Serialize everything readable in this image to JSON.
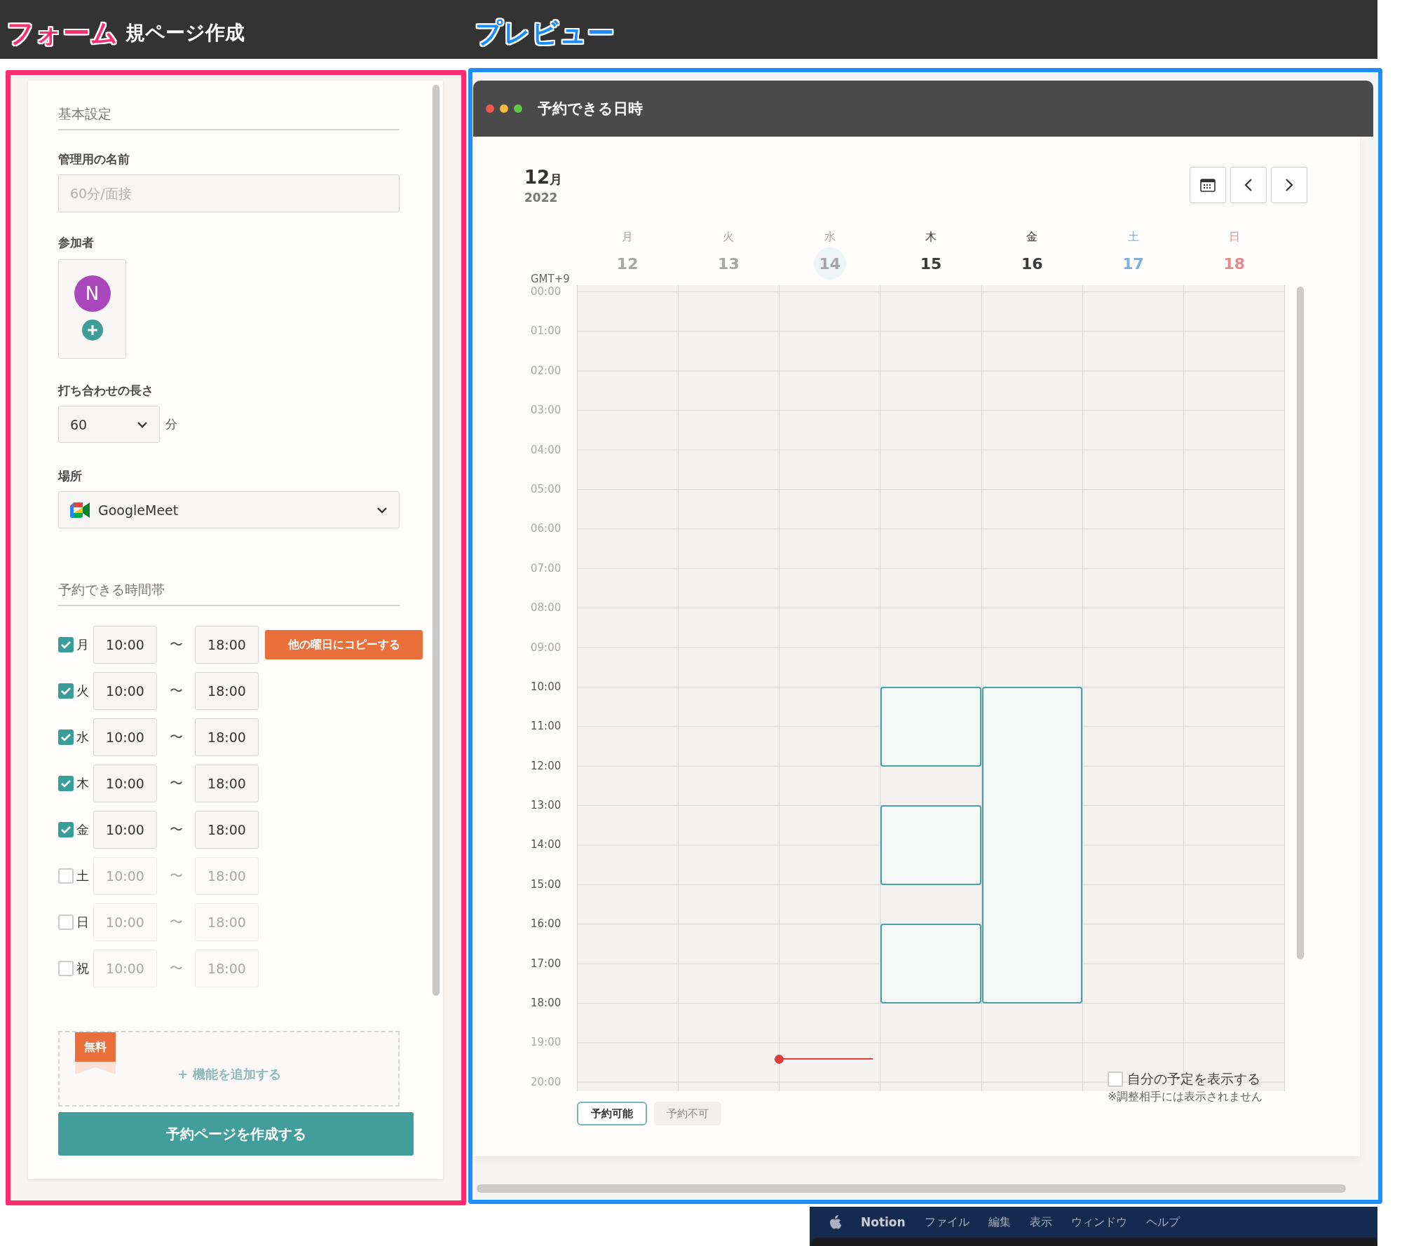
{
  "header": {
    "form_label": "フォーム",
    "page_title": "規ページ作成",
    "preview_label": "プレビュー"
  },
  "form": {
    "basic_section": "基本設定",
    "name_field": {
      "label": "管理用の名前",
      "placeholder": "60分/面接"
    },
    "participants": {
      "label": "参加者",
      "avatars": [
        {
          "initial": "N"
        }
      ]
    },
    "duration": {
      "label": "打ち合わせの長さ",
      "value": "60",
      "unit": "分"
    },
    "location": {
      "label": "場所",
      "value": "GoogleMeet"
    },
    "hours_section": "予約できる時間帯",
    "days": [
      {
        "label": "月",
        "checked": true,
        "start": "10:00",
        "separator": "〜",
        "end": "18:00"
      },
      {
        "label": "火",
        "checked": true,
        "start": "10:00",
        "separator": "〜",
        "end": "18:00"
      },
      {
        "label": "水",
        "checked": true,
        "start": "10:00",
        "separator": "〜",
        "end": "18:00"
      },
      {
        "label": "木",
        "checked": true,
        "start": "10:00",
        "separator": "〜",
        "end": "18:00"
      },
      {
        "label": "金",
        "checked": true,
        "start": "10:00",
        "separator": "〜",
        "end": "18:00"
      },
      {
        "label": "土",
        "checked": false,
        "start": "10:00",
        "separator": "〜",
        "end": "18:00"
      },
      {
        "label": "日",
        "checked": false,
        "start": "10:00",
        "separator": "〜",
        "end": "18:00"
      },
      {
        "label": "祝",
        "checked": false,
        "start": "10:00",
        "separator": "〜",
        "end": "18:00"
      }
    ],
    "copy_button": "他の曜日にコピーする",
    "add_feature": {
      "badge": "無料",
      "label": "+ 機能を追加する"
    },
    "submit_button": "予約ページを作成する"
  },
  "preview": {
    "window_title": "予約できる日時",
    "month": "12",
    "month_unit": "月",
    "year": "2022",
    "timezone": "GMT+9",
    "days": [
      {
        "weekday": "月",
        "date": "12",
        "kind": "weekday",
        "available": false,
        "today": false
      },
      {
        "weekday": "火",
        "date": "13",
        "kind": "weekday",
        "available": false,
        "today": false
      },
      {
        "weekday": "水",
        "date": "14",
        "kind": "weekday",
        "available": false,
        "today": true
      },
      {
        "weekday": "木",
        "date": "15",
        "kind": "weekday",
        "available": true,
        "today": false,
        "open_hours": [
          false,
          false,
          false,
          false,
          false,
          false,
          false,
          false,
          false,
          false,
          true,
          true,
          false,
          true,
          true,
          false,
          true,
          true,
          false,
          false
        ]
      },
      {
        "weekday": "金",
        "date": "16",
        "kind": "weekday",
        "available": true,
        "today": false,
        "open_hours": [
          false,
          false,
          false,
          false,
          false,
          false,
          false,
          false,
          false,
          false,
          true,
          true,
          true,
          true,
          true,
          true,
          true,
          true,
          false,
          false
        ]
      },
      {
        "weekday": "土",
        "date": "17",
        "kind": "saturday",
        "available": false,
        "today": false
      },
      {
        "weekday": "日",
        "date": "18",
        "kind": "sunday",
        "available": false,
        "today": false
      }
    ],
    "hours": [
      {
        "label": "00:00",
        "active": false
      },
      {
        "label": "01:00",
        "active": false
      },
      {
        "label": "02:00",
        "active": false
      },
      {
        "label": "03:00",
        "active": false
      },
      {
        "label": "04:00",
        "active": false
      },
      {
        "label": "05:00",
        "active": false
      },
      {
        "label": "06:00",
        "active": false
      },
      {
        "label": "07:00",
        "active": false
      },
      {
        "label": "08:00",
        "active": false
      },
      {
        "label": "09:00",
        "active": false
      },
      {
        "label": "10:00",
        "active": true
      },
      {
        "label": "11:00",
        "active": true
      },
      {
        "label": "12:00",
        "active": true
      },
      {
        "label": "13:00",
        "active": true
      },
      {
        "label": "14:00",
        "active": true
      },
      {
        "label": "15:00",
        "active": true
      },
      {
        "label": "16:00",
        "active": true
      },
      {
        "label": "17:00",
        "active": true
      },
      {
        "label": "18:00",
        "active": true
      },
      {
        "label": "19:00",
        "active": false,
        "current": true
      },
      {
        "label": "20:00",
        "active": false
      }
    ],
    "legend": [
      {
        "label": "予約可能",
        "selected": true
      },
      {
        "label": "予約不可",
        "selected": false
      }
    ],
    "show_own_schedule": {
      "label": "自分の予定を表示する",
      "checked": false
    },
    "note": "※調整相手には表示されません"
  },
  "menu_bar": {
    "items": [
      {
        "label": "Notion",
        "kind": "app"
      },
      {
        "label": "ファイル",
        "kind": "menu"
      },
      {
        "label": "編集",
        "kind": "menu"
      },
      {
        "label": "表示",
        "kind": "menu"
      },
      {
        "label": "ウィンドウ",
        "kind": "menu"
      },
      {
        "label": "ヘルプ",
        "kind": "menu"
      }
    ]
  }
}
